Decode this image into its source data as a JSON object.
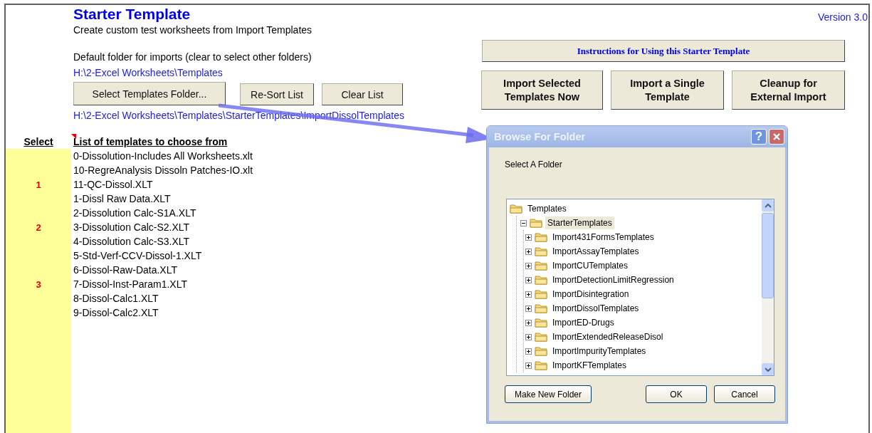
{
  "title": "Starter Template",
  "subtitle": "Create custom test worksheets from Import Templates",
  "version": "Version 3.0",
  "default_folder_label": "Default folder for imports (clear to select other folders)",
  "default_folder_path": "H:\\2-Excel Worksheets\\Templates",
  "folder_buttons": [
    "Select Templates Folder...",
    "Re-Sort List",
    "Clear List"
  ],
  "current_folder_path": "H:\\2-Excel Worksheets\\Templates\\StarterTemplates\\ImportDissolTemplates",
  "instructions_button": "Instructions for Using this Starter Template",
  "action_buttons": [
    "Import Selected Templates Now",
    "Import a Single Template",
    "Cleanup for External Import"
  ],
  "list_headers": {
    "select": "Select",
    "templates": "List of templates to choose from"
  },
  "templates": [
    {
      "name": "0-Dissolution-Includes All Worksheets.xlt"
    },
    {
      "name": "10-RegreAnalysis Dissoln Patches-IO.xlt"
    },
    {
      "name": "11-QC-Dissol.XLT",
      "select": "1"
    },
    {
      "name": "1-Dissl Raw Data.XLT"
    },
    {
      "name": "2-Dissolution Calc-S1A.XLT"
    },
    {
      "name": "3-Dissolution Calc-S2.XLT",
      "select": "2"
    },
    {
      "name": "4-Dissolution Calc-S3.XLT"
    },
    {
      "name": "5-Std-Verf-CCV-Dissol-1.XLT"
    },
    {
      "name": "6-Dissol-Raw-Data.XLT"
    },
    {
      "name": "7-Dissol-Inst-Param1.XLT",
      "select": "3"
    },
    {
      "name": "8-Dissol-Calc1.XLT"
    },
    {
      "name": "9-Dissol-Calc2.XLT"
    }
  ],
  "dialog": {
    "title": "Browse For Folder",
    "help": "?",
    "prompt": "Select A Folder",
    "tree": [
      {
        "label": "Templates",
        "selected": false,
        "children": [
          {
            "label": "StarterTemplates",
            "expanded": true,
            "selected": true,
            "children": [
              {
                "label": "Import431FormsTemplates",
                "expanded": false,
                "selected": false
              },
              {
                "label": "ImportAssayTemplates",
                "expanded": false,
                "selected": false
              },
              {
                "label": "ImportCUTemplates",
                "expanded": false,
                "selected": false
              },
              {
                "label": "ImportDetectionLimitRegression",
                "expanded": false,
                "selected": false
              },
              {
                "label": "ImportDisintegration",
                "expanded": false,
                "selected": false
              },
              {
                "label": "ImportDissolTemplates",
                "expanded": false,
                "selected": false
              },
              {
                "label": "ImportED-Drugs",
                "expanded": false,
                "selected": false
              },
              {
                "label": "ImportExtendedReleaseDisol",
                "expanded": false,
                "selected": false
              },
              {
                "label": "ImportImpurityTemplates",
                "expanded": false,
                "selected": false
              },
              {
                "label": "ImportKFTemplates",
                "expanded": false,
                "selected": false
              }
            ]
          }
        ]
      }
    ],
    "buttons": [
      "Make New Folder",
      "OK",
      "Cancel"
    ]
  }
}
